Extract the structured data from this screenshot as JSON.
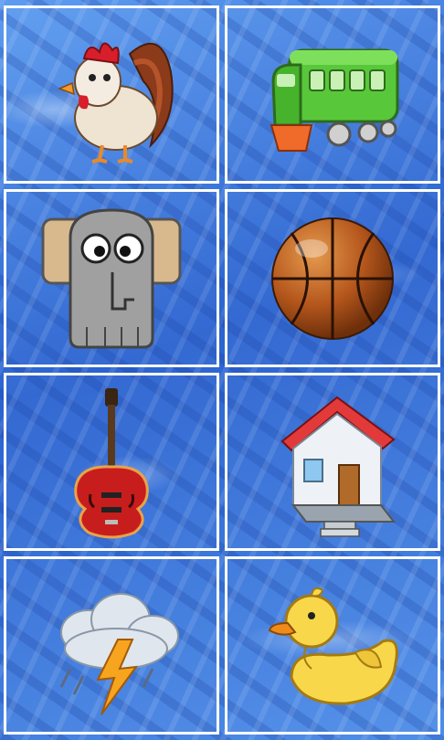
{
  "cards": [
    {
      "name": "rooster",
      "icon": "rooster-icon"
    },
    {
      "name": "train",
      "icon": "train-icon"
    },
    {
      "name": "elephant",
      "icon": "elephant-icon"
    },
    {
      "name": "basketball",
      "icon": "basketball-icon"
    },
    {
      "name": "guitar",
      "icon": "guitar-icon"
    },
    {
      "name": "house",
      "icon": "house-icon"
    },
    {
      "name": "storm-cloud",
      "icon": "storm-cloud-icon"
    },
    {
      "name": "duck",
      "icon": "duck-icon"
    }
  ],
  "colors": {
    "background": "#2f6fd6",
    "card_border": "#ffffff"
  }
}
